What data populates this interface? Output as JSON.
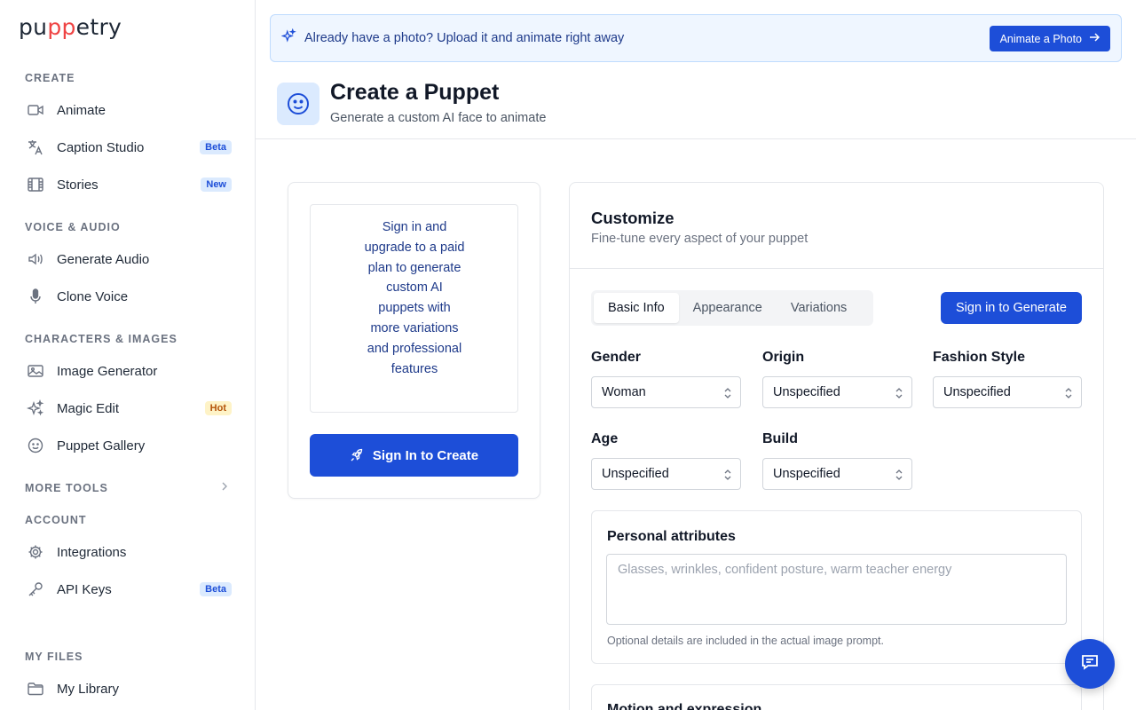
{
  "brand": {
    "pre": "pu",
    "accent": "pp",
    "post": "etry"
  },
  "sidebar": {
    "sections": {
      "create": "CREATE",
      "voice_audio": "VOICE & AUDIO",
      "characters_images": "CHARACTERS & IMAGES",
      "more_tools": "MORE TOOLS",
      "account": "ACCOUNT",
      "my_files": "MY FILES"
    },
    "items": {
      "animate": {
        "label": "Animate",
        "icon": "video-icon"
      },
      "caption_studio": {
        "label": "Caption Studio",
        "icon": "translate-icon",
        "badge": "Beta"
      },
      "stories": {
        "label": "Stories",
        "icon": "film-icon",
        "badge": "New"
      },
      "generate_audio": {
        "label": "Generate Audio",
        "icon": "speaker-icon"
      },
      "clone_voice": {
        "label": "Clone Voice",
        "icon": "microphone-icon"
      },
      "image_generator": {
        "label": "Image Generator",
        "icon": "image-icon"
      },
      "magic_edit": {
        "label": "Magic Edit",
        "icon": "sparkles-icon",
        "badge": "Hot"
      },
      "puppet_gallery": {
        "label": "Puppet Gallery",
        "icon": "smiley-icon"
      },
      "integrations": {
        "label": "Integrations",
        "icon": "gear-icon"
      },
      "api_keys": {
        "label": "API Keys",
        "icon": "key-icon",
        "badge": "Beta"
      },
      "my_library": {
        "label": "My Library",
        "icon": "folder-icon"
      }
    }
  },
  "banner": {
    "text": "Already have a photo? Upload it and animate right away",
    "button": "Animate a Photo"
  },
  "header": {
    "title": "Create a Puppet",
    "subtitle": "Generate a custom AI face to animate"
  },
  "preview": {
    "message": "Sign in and upgrade to a paid plan to generate custom AI puppets with more variations and professional features",
    "button": "Sign In to Create"
  },
  "customize": {
    "title": "Customize",
    "subtitle": "Fine-tune every aspect of your puppet",
    "tabs": [
      "Basic Info",
      "Appearance",
      "Variations"
    ],
    "active_tab": "Basic Info",
    "generate_button": "Sign in to Generate",
    "fields": {
      "gender": {
        "label": "Gender",
        "value": "Woman"
      },
      "origin": {
        "label": "Origin",
        "value": "Unspecified"
      },
      "fashion_style": {
        "label": "Fashion Style",
        "value": "Unspecified"
      },
      "age": {
        "label": "Age",
        "value": "Unspecified"
      },
      "build": {
        "label": "Build",
        "value": "Unspecified"
      }
    },
    "personal_attributes": {
      "title": "Personal attributes",
      "placeholder": "Glasses, wrinkles, confident posture, warm teacher energy",
      "help": "Optional details are included in the actual image prompt."
    },
    "motion": {
      "title": "Motion and expression"
    }
  },
  "colors": {
    "primary": "#1d4ed8",
    "banner_bg": "#eff6ff",
    "logo_accent": "#ef4444"
  }
}
